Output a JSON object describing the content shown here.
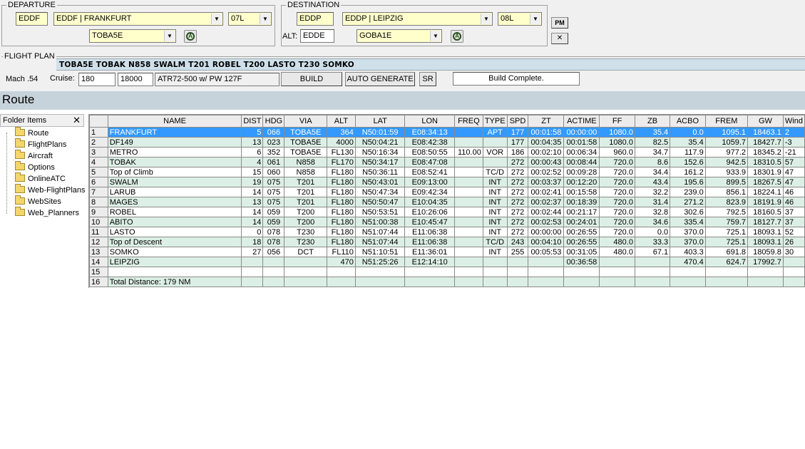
{
  "departure": {
    "legend": "DEPARTURE",
    "icao": "EDDF",
    "airport": "EDDF | FRANKFURT",
    "runway": "07L",
    "sid": "TOBA5E"
  },
  "destination": {
    "legend": "DESTINATION",
    "icao": "EDDP",
    "airport": "EDDP | LEIPZIG",
    "runway": "08L",
    "alt_label": "ALT:",
    "alternate": "EDDE",
    "star": "GOBA1E"
  },
  "buttons": {
    "pm": "PM",
    "close": "✕",
    "build": "BUILD",
    "auto_generate": "AUTO GENERATE",
    "sr": "SR"
  },
  "flight_plan": {
    "legend": "FLIGHT PLAN",
    "route": "TOBA5E TOBAK N858 SWALM T201 ROBEL T200 LASTO T230 SOMKO",
    "mach": "Mach .54",
    "cruise_label": "Cruise:",
    "cruise_speed": "180",
    "cruise_alt": "18000",
    "aircraft": "ATR72-500 w/ PW 127F",
    "status": "Build Complete."
  },
  "route_title": "Route",
  "folders": {
    "header": "Folder Items",
    "close": "✕",
    "items": [
      "Route",
      "FlightPlans",
      "Aircraft",
      "Options",
      "OnlineATC",
      "Web-FlightPlans",
      "WebSites",
      "Web_Planners"
    ]
  },
  "table": {
    "columns": [
      "",
      "NAME",
      "DIST",
      "HDG",
      "VIA",
      "ALT",
      "LAT",
      "LON",
      "FREQ",
      "TYPE",
      "SPD",
      "ZT",
      "ACTIME",
      "FF",
      "ZB",
      "ACBO",
      "FREM",
      "GW",
      "Wind"
    ],
    "rows": [
      [
        "1",
        "FRANKFURT",
        "5",
        "066",
        "TOBA5E",
        "364",
        "N50:01:59",
        "E08:34:13",
        "",
        "APT",
        "177",
        "00:01:58",
        "00:00:00",
        "1080.0",
        "35.4",
        "0.0",
        "1095.1",
        "18463.1",
        "2"
      ],
      [
        "2",
        "DF149",
        "13",
        "023",
        "TOBA5E",
        "4000",
        "N50:04:21",
        "E08:42:38",
        "",
        "",
        "177",
        "00:04:35",
        "00:01:58",
        "1080.0",
        "82.5",
        "35.4",
        "1059.7",
        "18427.7",
        "-3"
      ],
      [
        "3",
        "METRO",
        "6",
        "352",
        "TOBA5E",
        "FL130",
        "N50:16:34",
        "E08:50:55",
        "110.00",
        "VOR",
        "186",
        "00:02:10",
        "00:06:34",
        "960.0",
        "34.7",
        "117.9",
        "977.2",
        "18345.2",
        "-21"
      ],
      [
        "4",
        "TOBAK",
        "4",
        "061",
        "N858",
        "FL170",
        "N50:34:17",
        "E08:47:08",
        "",
        "",
        "272",
        "00:00:43",
        "00:08:44",
        "720.0",
        "8.6",
        "152.6",
        "942.5",
        "18310.5",
        "57"
      ],
      [
        "5",
        "Top of Climb",
        "15",
        "060",
        "N858",
        "FL180",
        "N50:36:11",
        "E08:52:41",
        "",
        "TC/D",
        "272",
        "00:02:52",
        "00:09:28",
        "720.0",
        "34.4",
        "161.2",
        "933.9",
        "18301.9",
        "47"
      ],
      [
        "6",
        "SWALM",
        "19",
        "075",
        "T201",
        "FL180",
        "N50:43:01",
        "E09:13:00",
        "",
        "INT",
        "272",
        "00:03:37",
        "00:12:20",
        "720.0",
        "43.4",
        "195.6",
        "899.5",
        "18267.5",
        "47"
      ],
      [
        "7",
        "LARUB",
        "14",
        "075",
        "T201",
        "FL180",
        "N50:47:34",
        "E09:42:34",
        "",
        "INT",
        "272",
        "00:02:41",
        "00:15:58",
        "720.0",
        "32.2",
        "239.0",
        "856.1",
        "18224.1",
        "46"
      ],
      [
        "8",
        "MAGES",
        "13",
        "075",
        "T201",
        "FL180",
        "N50:50:47",
        "E10:04:35",
        "",
        "INT",
        "272",
        "00:02:37",
        "00:18:39",
        "720.0",
        "31.4",
        "271.2",
        "823.9",
        "18191.9",
        "46"
      ],
      [
        "9",
        "ROBEL",
        "14",
        "059",
        "T200",
        "FL180",
        "N50:53:51",
        "E10:26:06",
        "",
        "INT",
        "272",
        "00:02:44",
        "00:21:17",
        "720.0",
        "32.8",
        "302.6",
        "792.5",
        "18160.5",
        "37"
      ],
      [
        "10",
        "ABITO",
        "14",
        "059",
        "T200",
        "FL180",
        "N51:00:38",
        "E10:45:47",
        "",
        "INT",
        "272",
        "00:02:53",
        "00:24:01",
        "720.0",
        "34.6",
        "335.4",
        "759.7",
        "18127.7",
        "37"
      ],
      [
        "11",
        "LASTO",
        "0",
        "078",
        "T230",
        "FL180",
        "N51:07:44",
        "E11:06:38",
        "",
        "INT",
        "272",
        "00:00:00",
        "00:26:55",
        "720.0",
        "0.0",
        "370.0",
        "725.1",
        "18093.1",
        "52"
      ],
      [
        "12",
        "Top of Descent",
        "18",
        "078",
        "T230",
        "FL180",
        "N51:07:44",
        "E11:06:38",
        "",
        "TC/D",
        "243",
        "00:04:10",
        "00:26:55",
        "480.0",
        "33.3",
        "370.0",
        "725.1",
        "18093.1",
        "26"
      ],
      [
        "13",
        "SOMKO",
        "27",
        "056",
        "DCT",
        "FL110",
        "N51:10:51",
        "E11:36:01",
        "",
        "INT",
        "255",
        "00:05:53",
        "00:31:05",
        "480.0",
        "67.1",
        "403.3",
        "691.8",
        "18059.8",
        "30"
      ],
      [
        "14",
        "LEIPZIG",
        "",
        "",
        "",
        "470",
        "N51:25:26",
        "E12:14:10",
        "",
        "",
        "",
        "",
        "00:36:58",
        "",
        "",
        "470.4",
        "624.7",
        "17992.7",
        ""
      ],
      [
        "15",
        "",
        "",
        "",
        "",
        "",
        "",
        "",
        "",
        "",
        "",
        "",
        "",
        "",
        "",
        "",
        "",
        "",
        ""
      ],
      [
        "16",
        "Total Distance: 179 NM",
        "",
        "",
        "",
        "",
        "",
        "",
        "",
        "",
        "",
        "",
        "",
        "",
        "",
        "",
        "",
        "",
        ""
      ]
    ]
  }
}
